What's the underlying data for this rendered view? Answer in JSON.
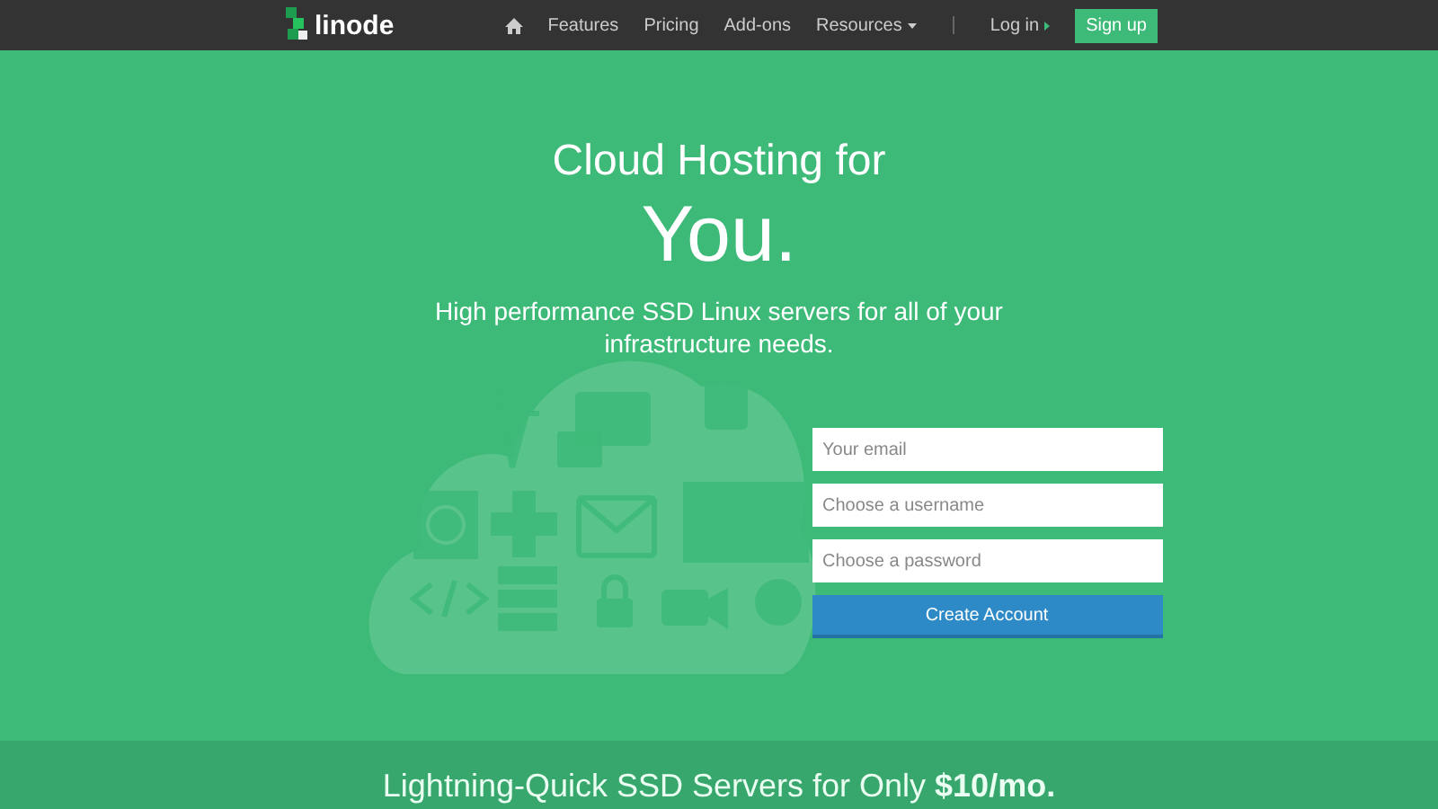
{
  "navbar": {
    "logo": "linode",
    "links": [
      {
        "label": "Features"
      },
      {
        "label": "Pricing"
      },
      {
        "label": "Add-ons"
      },
      {
        "label": "Resources",
        "dropdown": true
      }
    ],
    "login": "Log in",
    "signup": "Sign up"
  },
  "hero": {
    "title": "Cloud Hosting for",
    "headline": "You.",
    "subtitle": "High performance SSD Linux servers for all of your infrastructure needs."
  },
  "signup_form": {
    "fields": [
      {
        "placeholder": "Your email"
      },
      {
        "placeholder": "Choose a username"
      },
      {
        "placeholder": "Choose a password"
      }
    ],
    "button": "Create Account"
  },
  "banner": {
    "text": "Lightning-Quick SSD Servers for Only **$10/mo.**"
  }
}
